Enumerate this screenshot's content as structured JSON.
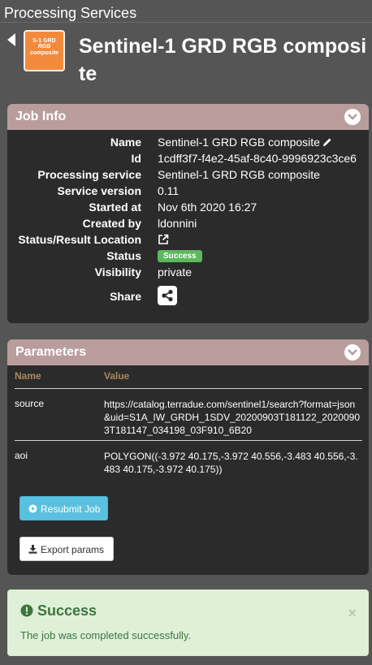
{
  "topbar": {
    "title": "Processing Services"
  },
  "header": {
    "logo": {
      "line1": "S-1 GRD",
      "line2": "RGB",
      "line3": "composite"
    },
    "title": "Sentinel-1 GRD RGB composite"
  },
  "job_info": {
    "title": "Job Info",
    "rows": [
      {
        "label": "Name",
        "value": "Sentinel-1 GRD RGB composite"
      },
      {
        "label": "Id",
        "value": "1cdff3f7-f4e2-45af-8c40-9996923c3ce6"
      },
      {
        "label": "Processing service",
        "value": "Sentinel-1 GRD RGB composite"
      },
      {
        "label": "Service version",
        "value": "0.11"
      },
      {
        "label": "Started at",
        "value": "Nov 6th 2020 16:27"
      },
      {
        "label": "Created by",
        "value": "ldonnini"
      },
      {
        "label": "Status/Result Location",
        "value": ""
      },
      {
        "label": "Status",
        "value": "Success"
      },
      {
        "label": "Visibility",
        "value": "private"
      },
      {
        "label": "Share",
        "value": ""
      }
    ]
  },
  "parameters": {
    "title": "Parameters",
    "columns": [
      "Name",
      "Value"
    ],
    "rows": [
      {
        "name": "source",
        "value": "https://catalog.terradue.com/sentinel1/search?format=json&uid=S1A_IW_GRDH_1SDV_20200903T181122_20200903T181147_034198_03F910_6B20"
      },
      {
        "name": "aoi",
        "value": "POLYGON((-3.972 40.175,-3.972 40.556,-3.483 40.556,-3.483 40.175,-3.972 40.175))"
      }
    ],
    "resubmit_label": "Resubmit Job",
    "export_label": "Export params"
  },
  "alert": {
    "title": "Success",
    "message": "The job was completed successfully.",
    "close": "×"
  },
  "colors": {
    "panel_header": "#b99d9d",
    "panel_body": "#2b2b2b",
    "success": "#5cb85c",
    "info_button": "#5bc0de",
    "logo": "#f28a3c"
  }
}
